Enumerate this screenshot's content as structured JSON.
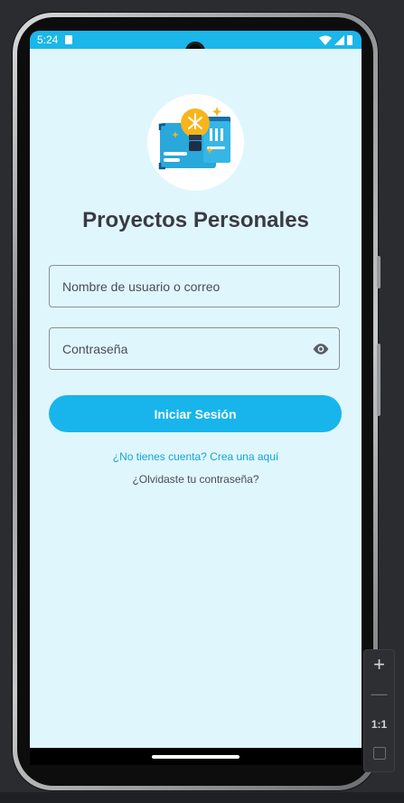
{
  "status_bar": {
    "time": "5:24",
    "icons": [
      "sd-card-icon",
      "wifi-icon",
      "signal-icon",
      "battery-icon"
    ],
    "color": "#1bb6ea"
  },
  "app": {
    "title": "Proyectos Personales",
    "logo": "lightbulb-blueprint-icon",
    "username_placeholder": "Nombre de usuario o correo",
    "username_value": "",
    "password_placeholder": "Contraseña",
    "password_value": "",
    "password_toggle_icon": "eye-icon",
    "login_label": "Iniciar Sesión",
    "register_link": "¿No tienes cuenta? Crea una aquí",
    "forgot_link": "¿Olvidaste tu contraseña?",
    "background": "#e0f6fd",
    "accent": "#17b5ec"
  },
  "zoom_controls": {
    "zoom_in": "+",
    "zoom_out": "—",
    "reset": "1:1",
    "fit_icon": "fit-screen-icon"
  }
}
